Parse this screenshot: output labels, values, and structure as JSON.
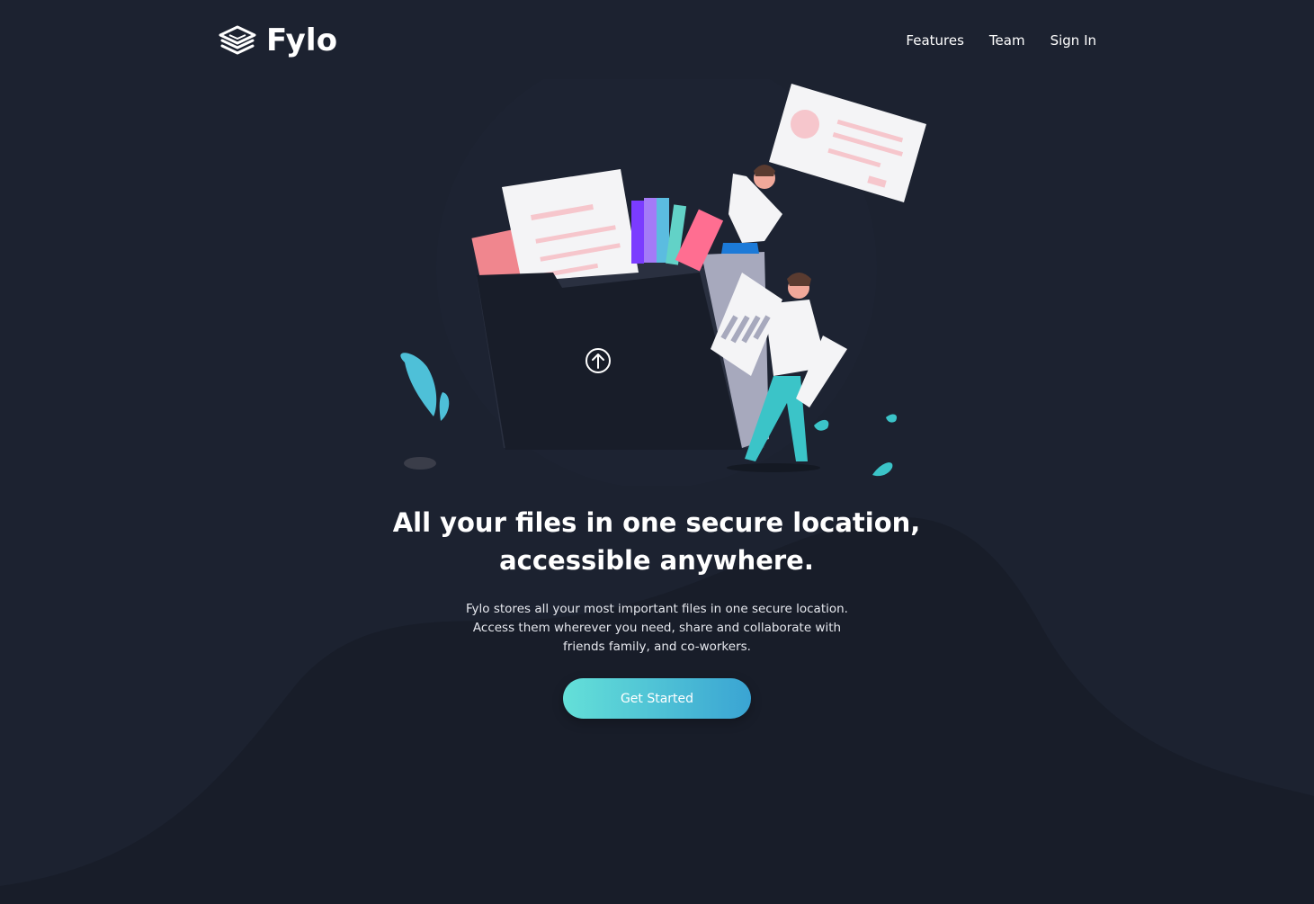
{
  "brand": {
    "name": "Fylo",
    "icon": "layers-icon"
  },
  "nav": {
    "items": [
      {
        "label": "Features"
      },
      {
        "label": "Team"
      },
      {
        "label": "Sign In"
      }
    ]
  },
  "hero": {
    "title_line1": "All your files in one secure location,",
    "title_line2": "accessible anywhere.",
    "description_line1": "Fylo stores all your most important files in one secure location.",
    "description_line2": "Access them wherever you need, share and collaborate with",
    "description_line3": "friends family, and co-workers.",
    "cta_label": "Get Started"
  },
  "colors": {
    "background": "#1c2230",
    "curve": "#181d29",
    "accent_start": "#64e0d8",
    "accent_end": "#3aa4d3",
    "text": "#ffffff"
  }
}
